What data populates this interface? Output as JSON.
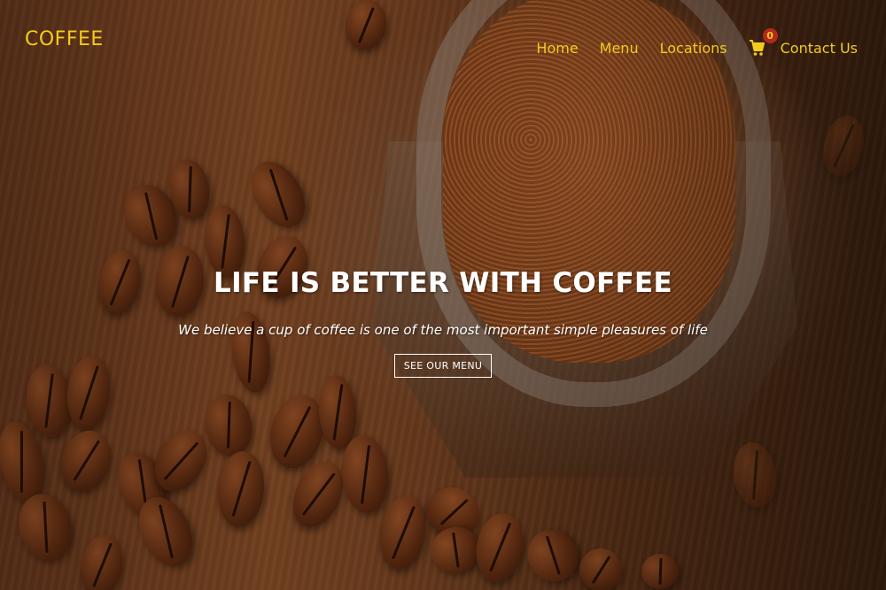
{
  "brand": "COFFEE",
  "nav": {
    "home": "Home",
    "menu": "Menu",
    "locations": "Locations",
    "cart_count": "0",
    "contact": "Contact Us"
  },
  "hero": {
    "title": "LIFE IS BETTER WITH COFFEE",
    "subtitle": "We believe a cup of coffee is one of the most important simple pleasures of life",
    "cta": "SEE OUR MENU"
  },
  "icons": {
    "cart": "shopping-cart-icon"
  },
  "colors": {
    "accent": "#f2cb1d",
    "badge": "#b5271c",
    "text_light": "#ffffff"
  }
}
